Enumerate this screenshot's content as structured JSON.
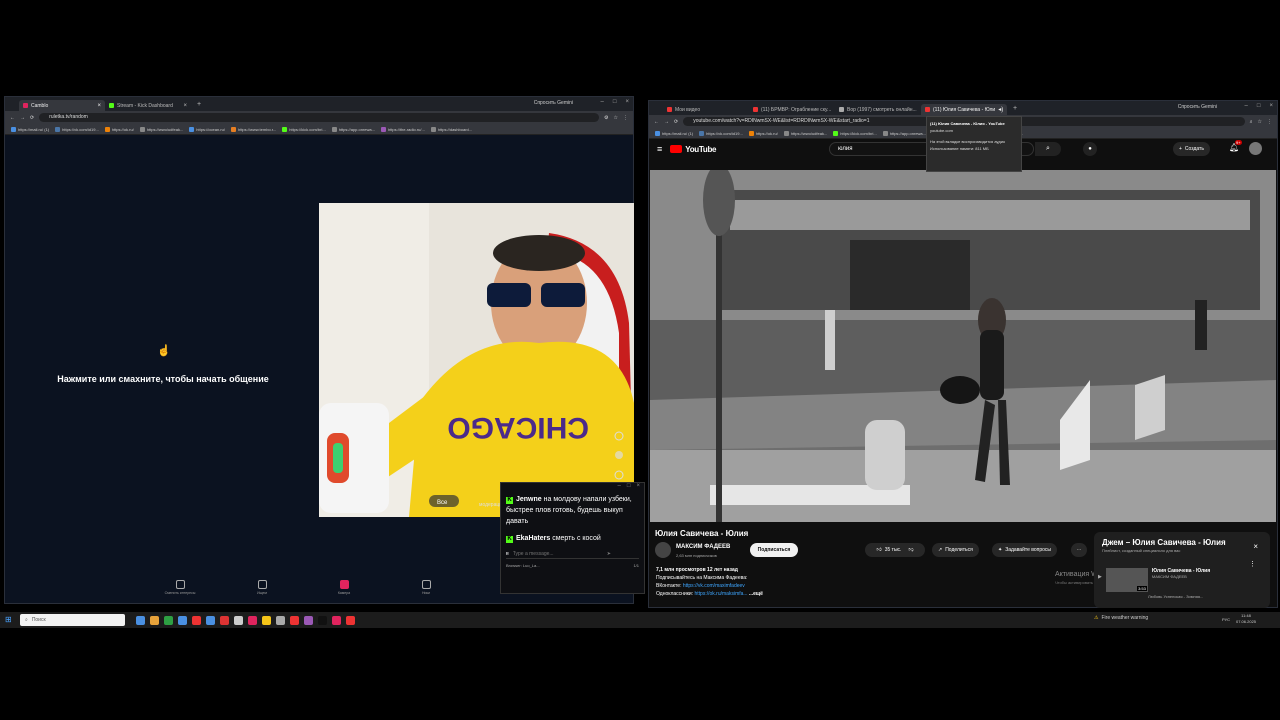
{
  "left_browser": {
    "tabs": [
      {
        "label": "Camblo",
        "active": true,
        "color": "#e0245e"
      },
      {
        "label": "Stream - Kick Dashboard",
        "active": false,
        "color": "#53fc18"
      }
    ],
    "gemini_label": "Спросить Gemini",
    "address": "ruletka.tv/random",
    "bookmarks": [
      "https://mail.ru/ (1)",
      "https://vk.com/id19...",
      "https://ok.ru/",
      "https://wwo/udfeak...",
      "https://ocean.ru/",
      "https://www.tembo.r...",
      "https://kick.com/bri...",
      "https://app.onrewa...",
      "https://the-radio.ru/...",
      "https://dashboard..."
    ]
  },
  "camblo": {
    "prompt": "Нажмите или смахните, чтобы начать общение",
    "nav": [
      {
        "label": "Сменить интересы",
        "active": false
      },
      {
        "label": "Ищем",
        "active": false
      },
      {
        "label": "Камера",
        "active": true
      },
      {
        "label": "Ники",
        "active": false
      },
      {
        "label": "Чаты",
        "active": false
      }
    ],
    "webcam_shirt_text": "CHICAGO",
    "webcam_badge": "Все",
    "webcam_side": "модерация"
  },
  "chat": {
    "messages": [
      {
        "user": "Jenwne",
        "text": "на молдову напали узбеки, быстрее плов готовь, будешь выкуп давать"
      },
      {
        "user": "EkaHaters",
        "text": "смерть с косой"
      }
    ],
    "input_placeholder": "Type a message...",
    "footer_left": "Browser: Luo_La...",
    "footer_right": "1/1"
  },
  "right_browser": {
    "tabs": [
      {
        "label": "Мои видео",
        "active": false
      },
      {
        "label": "(11) БРМВР: Ограбление ску...",
        "active": false
      },
      {
        "label": "Вор (1997) смотреть онлайн...",
        "active": false
      },
      {
        "label": "(11) Юлия Савичева - Юли",
        "active": true
      }
    ],
    "gemini_label": "Спросить Gemini",
    "address": "youtube.com/watch?v=RDINwmSX-WE&list=RDRDINwmSX-WE&start_radio=1",
    "bookmarks": [
      "https://mail.ru/ (1)",
      "https://vk.com/id19...",
      "https://ok.ru/",
      "https://wwo/udfeak...",
      "https://kick.com/bri...",
      "https://app.onrewa...",
      "https://the-radio.ru/...",
      "https://dashboard..."
    ]
  },
  "tooltip": {
    "title": "(11) Юлия Савичева - Юлия - YouTube",
    "domain": "youtube.com",
    "line1": "На этой вкладке воспроизводится аудио",
    "line2": "Использование памяти: 811 МБ"
  },
  "youtube": {
    "logo": "YouTube",
    "search_value": "юлия",
    "create_label": "Создать",
    "notif_count": "9+",
    "video_title": "Юлия Савичева - Юлия",
    "channel": "МАКСИМ ФАДЕЕВ",
    "subs": "2,63 млн подписчиков",
    "subscribe": "Подписаться",
    "likes": "35 тыс.",
    "share": "Поделиться",
    "ask": "Задавайте вопросы",
    "views": "7,1 млн просмотров  12 лет назад",
    "desc_line1": "Подписывайтесь на Максима Фадеева:",
    "desc_line2_label": "ВКонтакте:",
    "desc_line2_link": "https://vk.com/maximfadeev",
    "desc_line3_label": "Одноклассники:",
    "desc_line3_link": "https://ok.ru/maksimfa...",
    "more": "...ещё"
  },
  "playlist": {
    "title": "Джем – Юлия Савичева - Юлия",
    "subtitle": "Плейлист, созданный специально для вас",
    "item_title": "Юлия Савичева - Юлия",
    "item_channel": "МАКСИМ ФАДЕЕВ",
    "item_duration": "3:53",
    "item2_title": "Любовь Успенская - Зимняя..."
  },
  "activation": {
    "title": "Активация Windows",
    "sub": "Чтобы активировать Windows, перейдите в раздел \"Параметры\"."
  },
  "taskbar": {
    "search": "Поиск",
    "weather": "Fire weather warning",
    "lang": "РУС",
    "time": "11:48",
    "date": "07.06.2025",
    "icon_colors": [
      "#4a90e2",
      "#e8a33b",
      "#2ea043",
      "#4a90e2",
      "#e33",
      "#4a90e2",
      "#d33",
      "#ccc",
      "#e0245e",
      "#f5c518",
      "#aaa",
      "#e33",
      "#9b59b6",
      "#111",
      "#e0245e",
      "#e33"
    ]
  }
}
